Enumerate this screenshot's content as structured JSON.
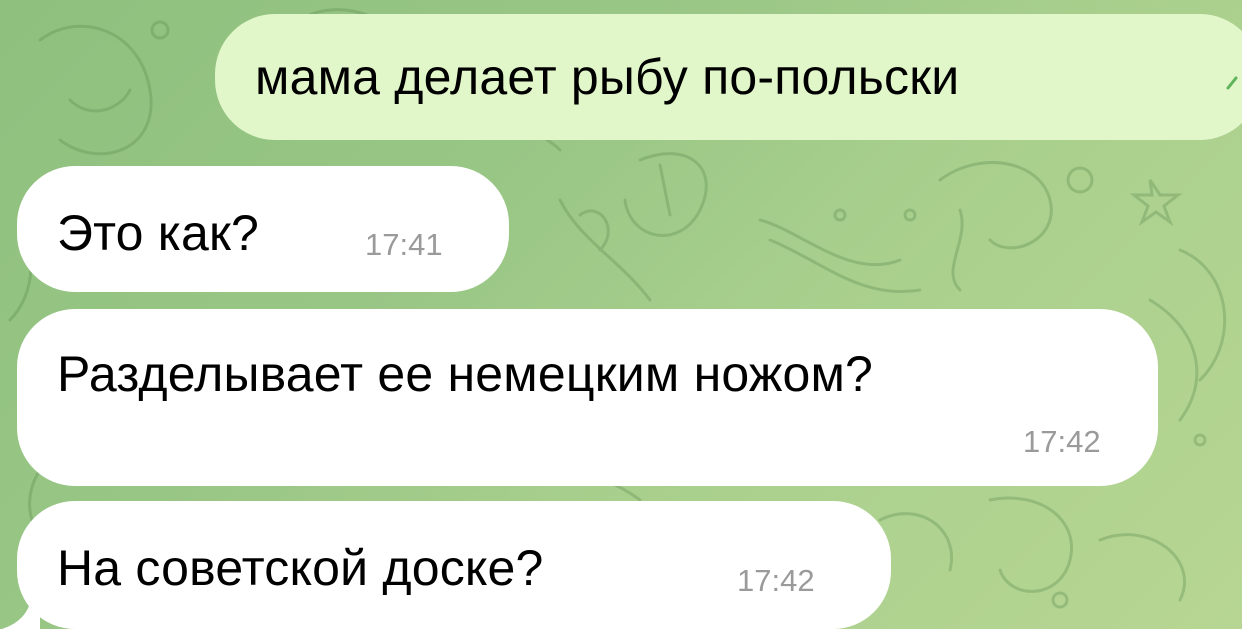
{
  "chat": {
    "outgoing": {
      "text": "мама делает рыбу по-польски"
    },
    "incoming": [
      {
        "text": "Это как?",
        "time": "17:41"
      },
      {
        "text": "Разделывает ее немецким ножом?",
        "time": "17:42"
      },
      {
        "text": "На советской доске?",
        "time": "17:42"
      }
    ]
  },
  "colors": {
    "outgoing_bubble": "#e1f6c9",
    "incoming_bubble": "#ffffff",
    "background": "#98c685",
    "timestamp": "#9a9a9a"
  }
}
